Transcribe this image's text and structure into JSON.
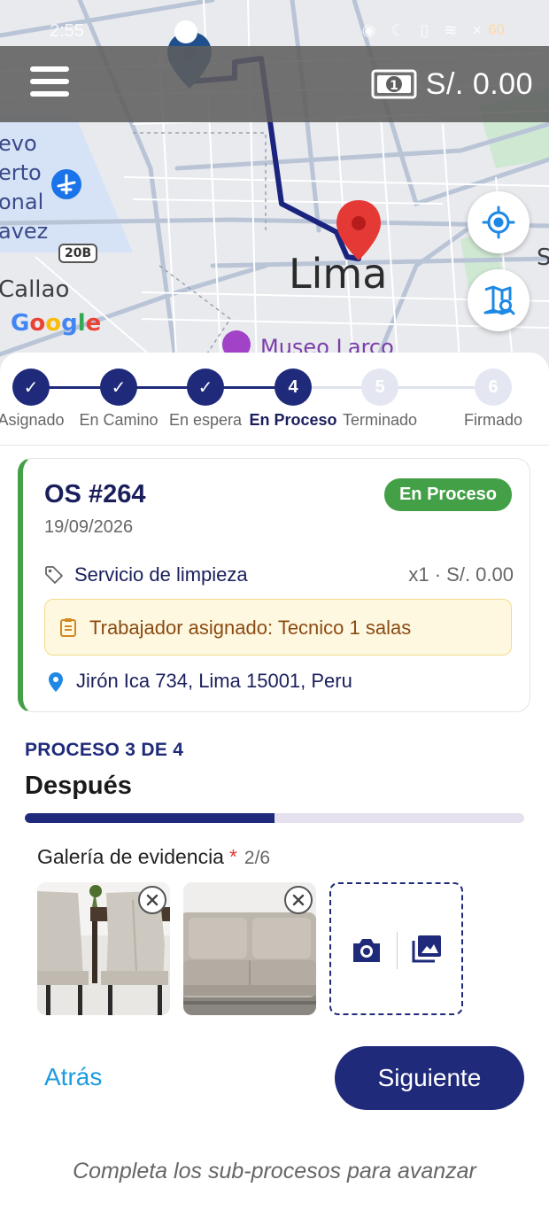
{
  "status_bar": {
    "time": "2:55",
    "right_icons": "◉ ☾ ▯ ≋ ×",
    "battery": "60"
  },
  "map": {
    "labels": {
      "city": "Lima",
      "district": "Callao",
      "airport": "evo\nerto\nonal\navez",
      "museum": "Museo Larco",
      "highway": "20B",
      "edge": "S"
    },
    "attribution": {
      "g1": "G",
      "g2": "o",
      "g3": "o",
      "g4": "g",
      "g5": "l",
      "g6": "e"
    },
    "route_color": "#1a237e",
    "destination_pin_color": "#e53935",
    "origin_pin_color": "#1f4f8c"
  },
  "header": {
    "menu_icon": "hamburger-icon",
    "balance": "S/. 0.00",
    "cash_icon": "cash-icon"
  },
  "map_controls": {
    "locate_icon": "crosshair-icon",
    "map_search_icon": "map-search-icon"
  },
  "stepper": {
    "steps": [
      {
        "label": "Asignado",
        "state": "done"
      },
      {
        "label": "En Camino",
        "state": "done"
      },
      {
        "label": "En espera",
        "state": "done"
      },
      {
        "label": "En Proceso",
        "number": "4",
        "state": "active"
      },
      {
        "label": "Terminado",
        "number": "5",
        "state": "todo"
      },
      {
        "label": "Firmado",
        "number": "6",
        "state": "todo"
      }
    ]
  },
  "order": {
    "title": "OS #264",
    "date": "19/09/2026",
    "status": "En Proceso",
    "status_color": "#43a047",
    "service_name": "Servicio de limpieza",
    "service_qty_price": "x1 · S/. 0.00",
    "worker": "Trabajador asignado: Tecnico 1 salas",
    "address": "Jirón Ica 734, Lima 15001, Peru"
  },
  "process": {
    "step_label": "PROCESO 3 DE 4",
    "title": "Después",
    "progress_fraction": 0.5
  },
  "gallery": {
    "label": "Galería de evidencia",
    "required_mark": "*",
    "count": "2/6",
    "photos": [
      {
        "subject": "chairs"
      },
      {
        "subject": "sofa"
      }
    ]
  },
  "actions": {
    "back": "Atrás",
    "next": "Siguiente"
  },
  "hint": "Completa los sub-procesos para avanzar"
}
